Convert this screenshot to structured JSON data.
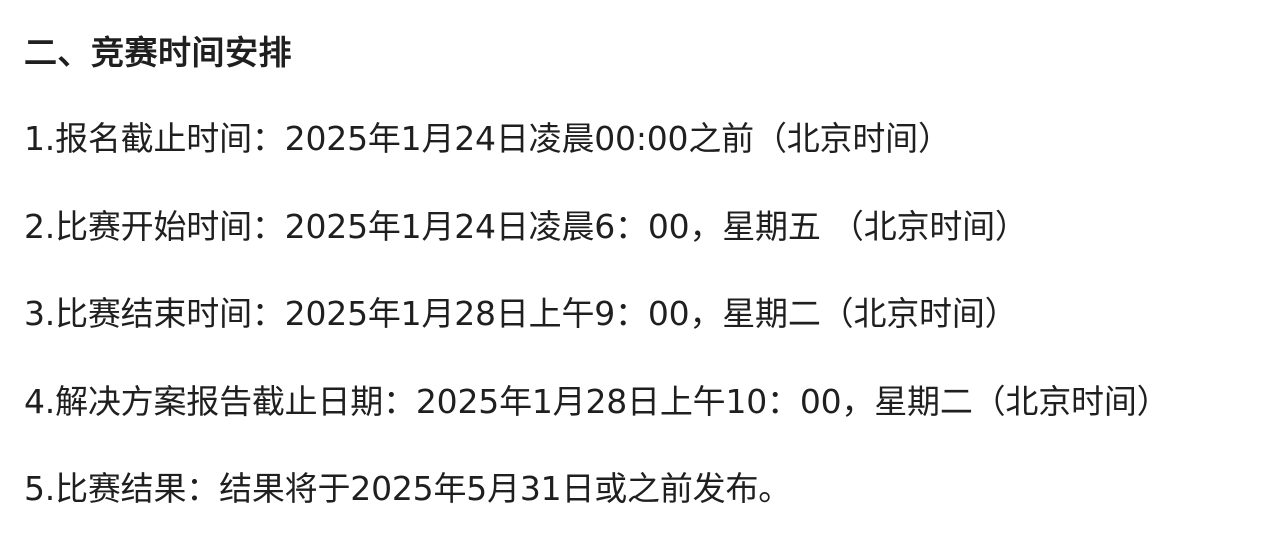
{
  "section": {
    "heading": "二、竞赛时间安排",
    "items": [
      "1.报名截止时间：2025年1月24日凌晨00:00之前（北京时间）",
      "2.比赛开始时间：2025年1月24日凌晨6：00，星期五 （北京时间）",
      "3.比赛结束时间：2025年1月28日上午9：00，星期二（北京时间）",
      "4.解决方案报告截止日期：2025年1月28日上午10：00，星期二（北京时间）",
      "5.比赛结果：结果将于2025年5月31日或之前发布。"
    ]
  }
}
